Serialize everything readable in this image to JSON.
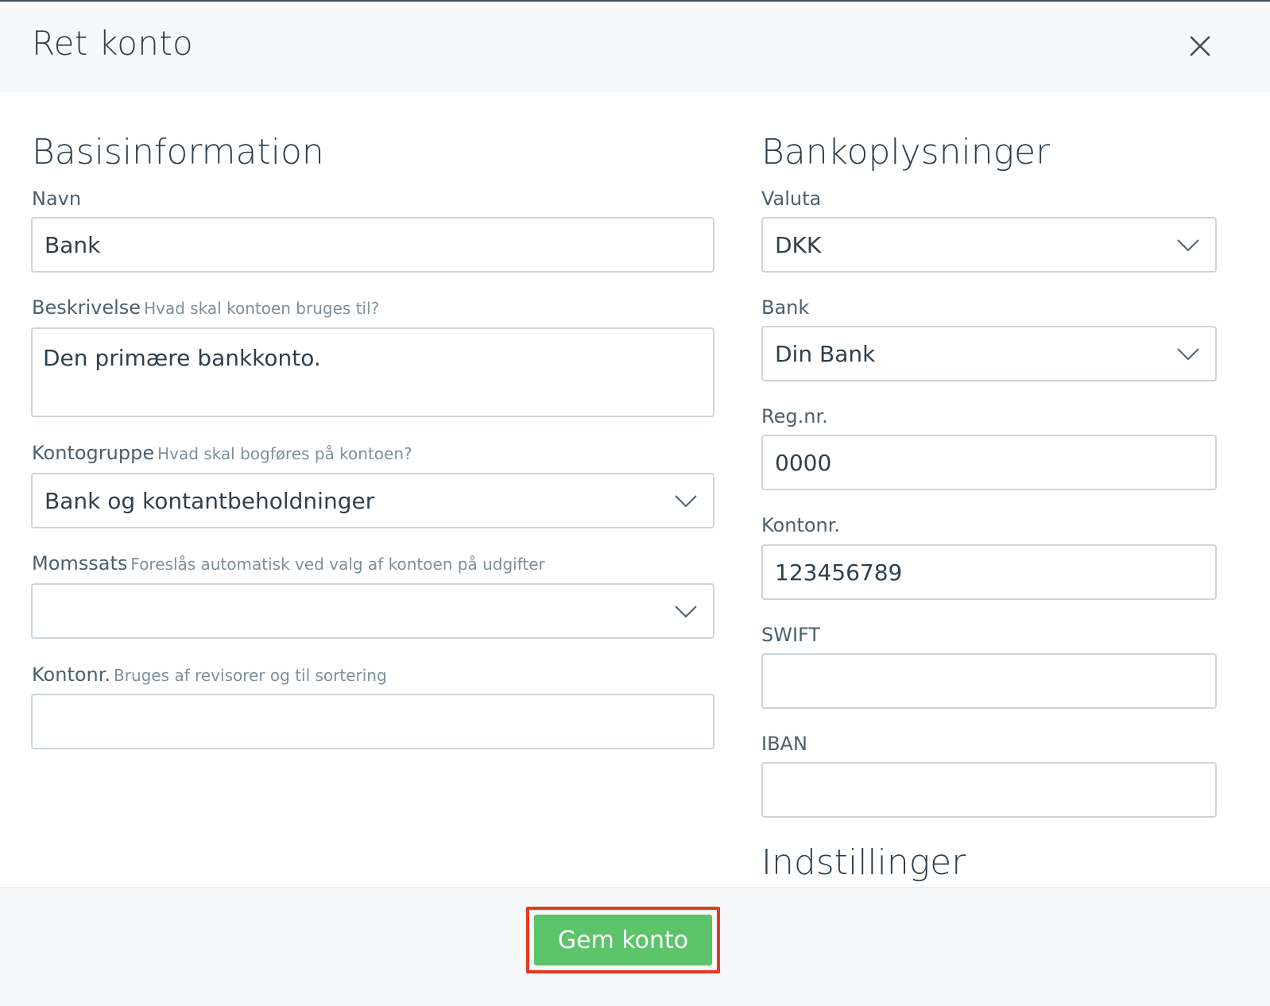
{
  "dialog": {
    "title": "Ret konto",
    "close_icon": "close-icon"
  },
  "basis": {
    "title": "Basisinformation",
    "navn": {
      "label": "Navn",
      "value": "Bank"
    },
    "beskrivelse": {
      "label": "Beskrivelse",
      "hint": "Hvad skal kontoen bruges til?",
      "value": "Den primære bankkonto."
    },
    "kontogruppe": {
      "label": "Kontogruppe",
      "hint": "Hvad skal bogføres på kontoen?",
      "value": "Bank og kontantbeholdninger"
    },
    "momssats": {
      "label": "Momssats",
      "hint": "Foreslås automatisk ved valg af kontoen på udgifter",
      "value": ""
    },
    "kontonr": {
      "label": "Kontonr.",
      "hint": "Bruges af revisorer og til sortering",
      "value": ""
    }
  },
  "bank": {
    "title": "Bankoplysninger",
    "valuta": {
      "label": "Valuta",
      "value": "DKK"
    },
    "bank": {
      "label": "Bank",
      "value": "Din Bank"
    },
    "regnr": {
      "label": "Reg.nr.",
      "value": "0000"
    },
    "kontonr": {
      "label": "Kontonr.",
      "value": "123456789"
    },
    "swift": {
      "label": "SWIFT",
      "value": ""
    },
    "iban": {
      "label": "IBAN",
      "value": ""
    }
  },
  "settings": {
    "title": "Indstillinger"
  },
  "footer": {
    "save_label": "Gem konto"
  },
  "colors": {
    "primary_button": "#5cc46a",
    "highlight_outline": "#e43a1f",
    "text": "#2f3f4c",
    "border": "#ccd5db"
  }
}
